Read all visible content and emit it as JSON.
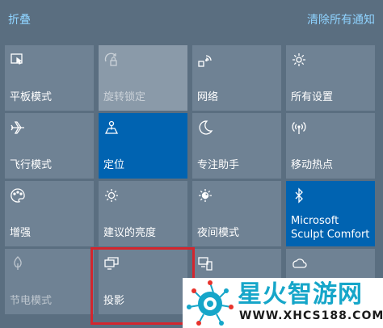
{
  "header": {
    "collapse_label": "折叠",
    "clear_all_label": "清除所有通知"
  },
  "tiles": [
    {
      "label": "平板模式",
      "icon": "tablet-mode-icon",
      "state": "normal"
    },
    {
      "label": "旋转锁定",
      "icon": "rotation-lock-icon",
      "state": "disabled"
    },
    {
      "label": "网络",
      "icon": "network-icon",
      "state": "normal"
    },
    {
      "label": "所有设置",
      "icon": "gear-icon",
      "state": "normal"
    },
    {
      "label": "飞行模式",
      "icon": "airplane-icon",
      "state": "normal"
    },
    {
      "label": "定位",
      "icon": "location-icon",
      "state": "active"
    },
    {
      "label": "专注助手",
      "icon": "moon-icon",
      "state": "normal"
    },
    {
      "label": "移动热点",
      "icon": "hotspot-icon",
      "state": "normal"
    },
    {
      "label": "增强",
      "icon": "palette-icon",
      "state": "normal"
    },
    {
      "label": "建议的亮度",
      "icon": "brightness-icon",
      "state": "normal"
    },
    {
      "label": "夜间模式",
      "icon": "night-light-icon",
      "state": "normal"
    },
    {
      "label": "Microsoft\nSculpt Comfort",
      "icon": "bluetooth-icon",
      "state": "active"
    },
    {
      "label": "节电模式",
      "icon": "battery-saver-icon",
      "state": "dim"
    },
    {
      "label": "投影",
      "icon": "project-icon",
      "state": "normal"
    },
    {
      "label": "",
      "icon": "connect-icon",
      "state": "normal"
    },
    {
      "label": "",
      "icon": "screen-snip-icon",
      "state": "normal"
    }
  ],
  "watermark": {
    "title": "星火智游网",
    "url": "WWW.XHCS188.COM"
  },
  "colors": {
    "panel_bg": "#5a6e80",
    "tile_bg": "#6f8294",
    "tile_active": "#0063b1",
    "link": "#8fd3ff",
    "highlight": "#d3262e"
  }
}
